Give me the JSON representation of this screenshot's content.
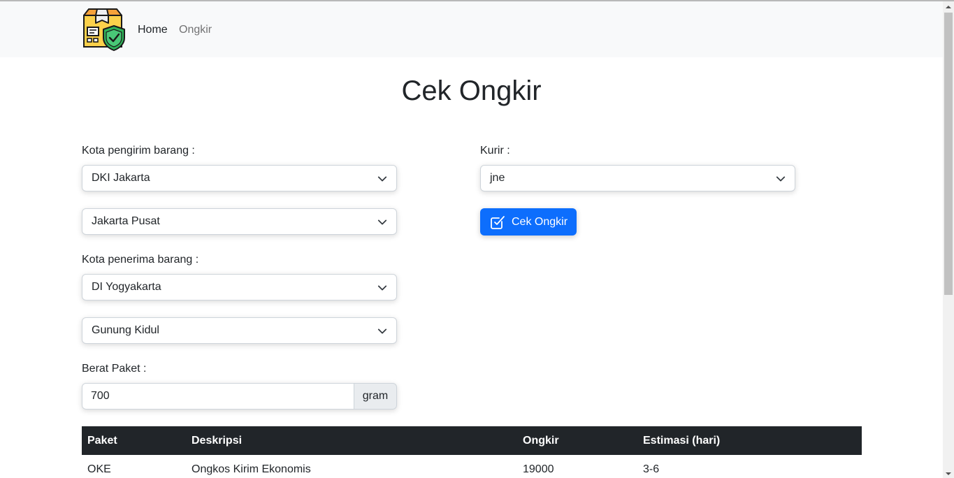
{
  "navbar": {
    "logo_icon": "package-shield-logo",
    "home_label": "Home",
    "ongkir_label": "Ongkir"
  },
  "page": {
    "title": "Cek Ongkir"
  },
  "form": {
    "sender_label": "Kota pengirim barang :",
    "sender_province": "DKI Jakarta",
    "sender_city": "Jakarta Pusat",
    "receiver_label": "Kota penerima barang :",
    "receiver_province": "DI Yogyakarta",
    "receiver_city": "Gunung Kidul",
    "weight_label": "Berat Paket :",
    "weight_value": "700",
    "weight_unit": "gram",
    "courier_label": "Kurir :",
    "courier_value": "jne",
    "submit_label": "Cek Ongkir",
    "submit_icon": "check-square-icon"
  },
  "table": {
    "headers": [
      "Paket",
      "Deskripsi",
      "Ongkir",
      "Estimasi (hari)"
    ],
    "rows": [
      [
        "OKE",
        "Ongkos Kirim Ekonomis",
        "19000",
        "3-6"
      ]
    ]
  },
  "colors": {
    "primary": "#0d6efd",
    "navbar_bg": "#f8f9fa",
    "table_header_bg": "#212529"
  }
}
